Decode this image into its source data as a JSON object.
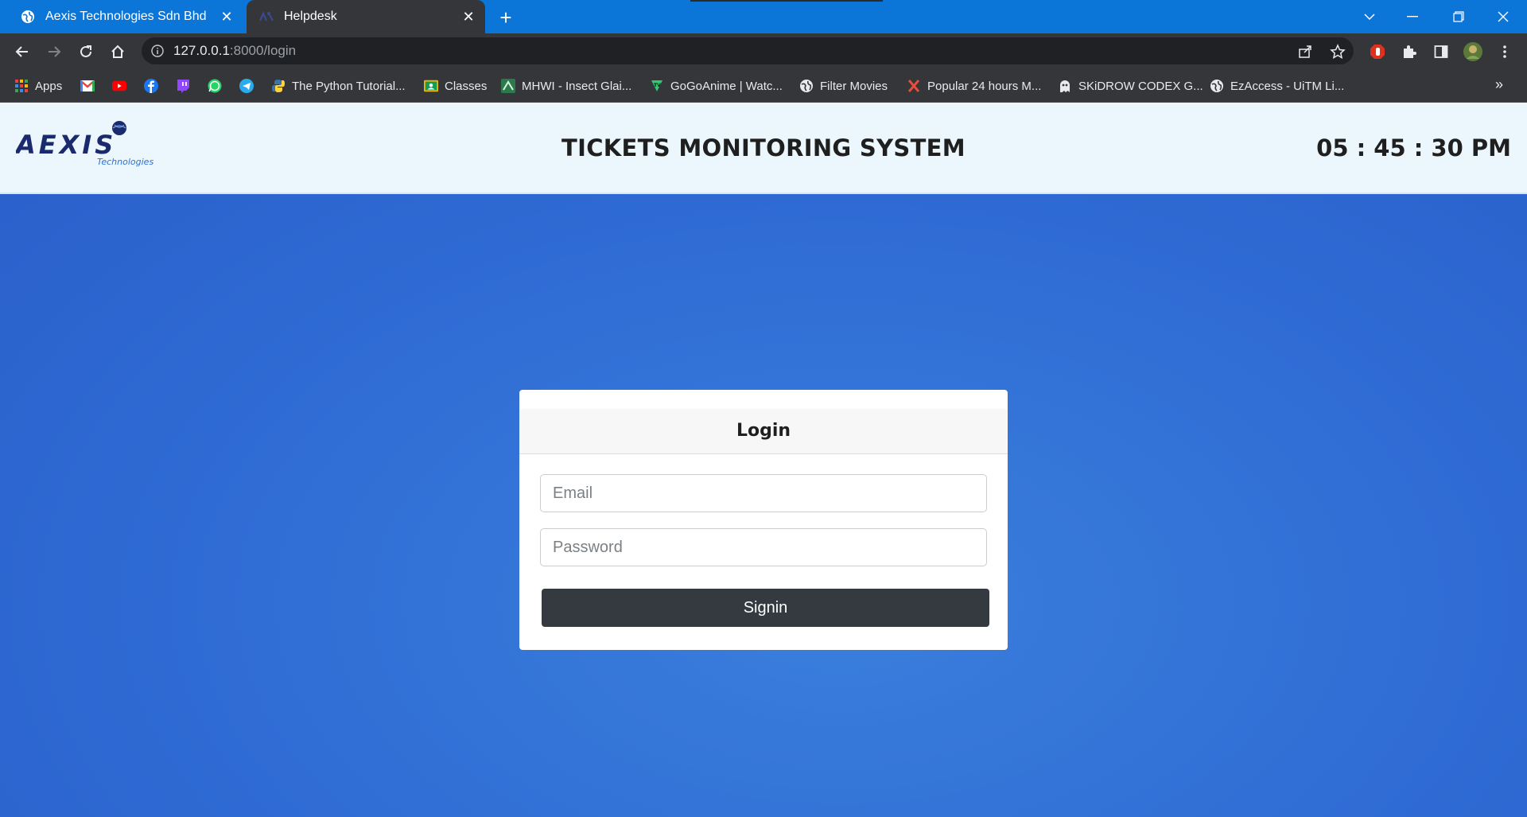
{
  "browser": {
    "tabs": [
      {
        "title": "Aexis Technologies Sdn Bhd",
        "active": false,
        "icon": "globe-icon"
      },
      {
        "title": "Helpdesk",
        "active": true,
        "icon": "site-favicon"
      }
    ],
    "address": {
      "host": "127.0.0.1",
      "path": ":8000/login"
    },
    "bookmarks": [
      {
        "label": "Apps",
        "icon": "apps-grid-icon"
      },
      {
        "label": "",
        "icon": "gmail-icon"
      },
      {
        "label": "",
        "icon": "youtube-icon"
      },
      {
        "label": "",
        "icon": "facebook-icon"
      },
      {
        "label": "",
        "icon": "twitch-icon"
      },
      {
        "label": "",
        "icon": "whatsapp-icon"
      },
      {
        "label": "",
        "icon": "telegram-icon"
      },
      {
        "label": "The Python Tutorial...",
        "icon": "python-icon"
      },
      {
        "label": "Classes",
        "icon": "classroom-icon"
      },
      {
        "label": "MHWI - Insect Glai...",
        "icon": "mhwi-icon"
      },
      {
        "label": "GoGoAnime | Watc...",
        "icon": "gogoanime-icon"
      },
      {
        "label": "Filter Movies",
        "icon": "globe-icon"
      },
      {
        "label": "Popular 24 hours M...",
        "icon": "x-red-icon"
      },
      {
        "label": "SKiDROW CODEX G...",
        "icon": "ghost-icon"
      },
      {
        "label": "EzAccess - UiTM Li...",
        "icon": "globe-icon"
      }
    ],
    "bookmarks_more": "»"
  },
  "header": {
    "logo_main": "AEXIS",
    "logo_sub": "Technologies",
    "title": "TICKETS MONITORING SYSTEM",
    "clock": "05 : 45 : 30 PM"
  },
  "login": {
    "heading": "Login",
    "email_placeholder": "Email",
    "password_placeholder": "Password",
    "submit_label": "Signin"
  },
  "colors": {
    "tabstrip": "#0b76d8",
    "toolbar": "#35363a",
    "page_bg": "#2f6fd6",
    "header_bg": "#ecf7fd",
    "button": "#343a40"
  }
}
